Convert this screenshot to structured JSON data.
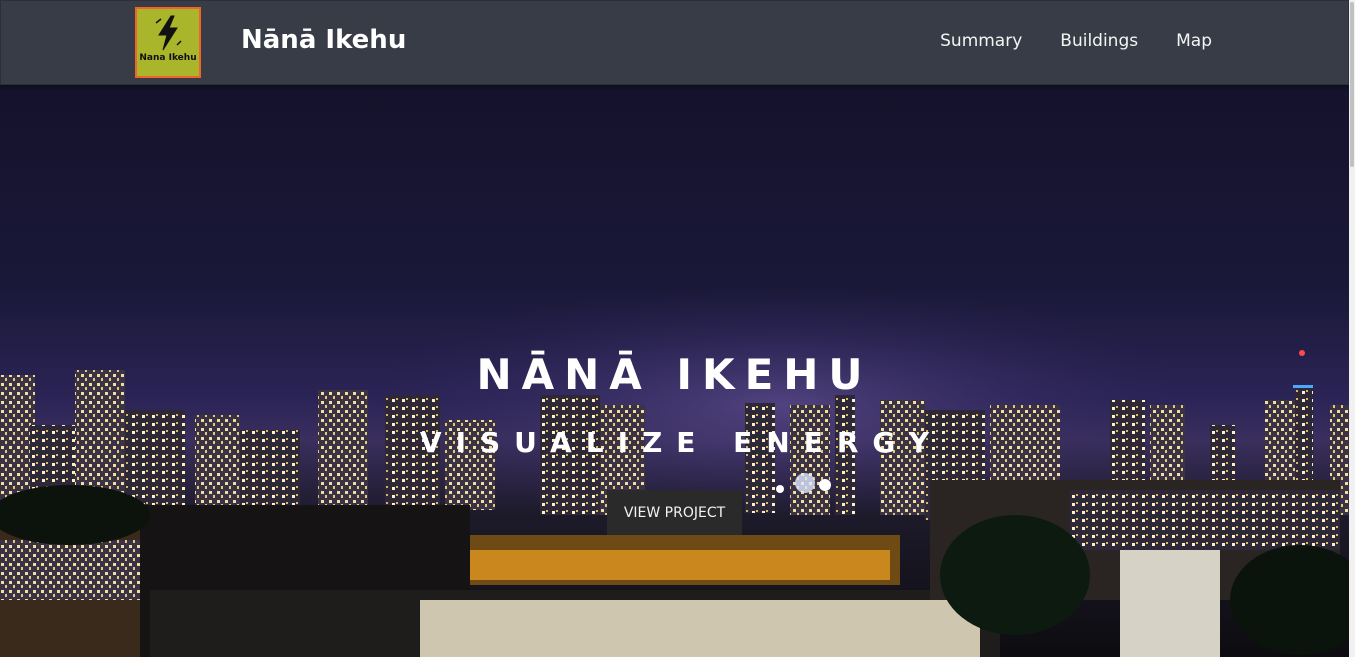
{
  "navbar": {
    "logo_text": "Nana Ikehu",
    "brand": "Nānā Ikehu",
    "links": [
      "Summary",
      "Buildings",
      "Map"
    ]
  },
  "hero": {
    "title": "NĀNĀ IKEHU",
    "subtitle": "VISUALIZE ENERGY",
    "button_label": "VIEW PROJECT"
  },
  "colors": {
    "navbar_bg": "#383c47",
    "logo_bg": "#a9b52a",
    "logo_border": "#f0642a",
    "button_bg": "#2b2a2a"
  },
  "icons": [
    "lightning-bolt-icon"
  ]
}
